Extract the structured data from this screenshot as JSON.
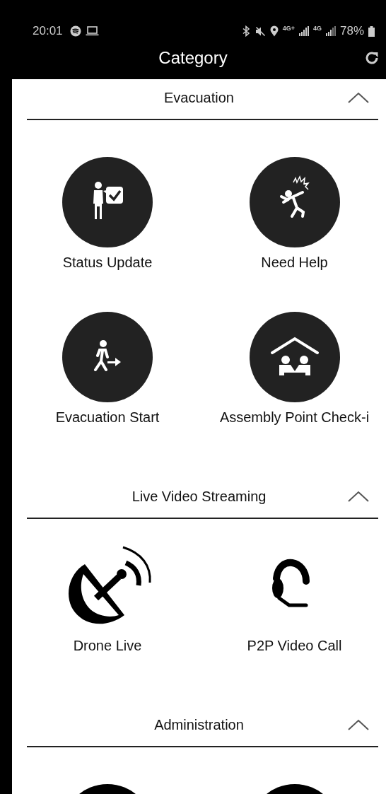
{
  "status_bar": {
    "time": "20:01",
    "network_1": "4G+",
    "network_2": "4G",
    "battery": "78%"
  },
  "header": {
    "title": "Category"
  },
  "sections": [
    {
      "title": "Evacuation",
      "expanded": true,
      "items": [
        {
          "label": "Status Update",
          "kind": "circle"
        },
        {
          "label": "Need Help",
          "kind": "circle"
        },
        {
          "label": "Evacuation Start",
          "kind": "circle"
        },
        {
          "label": "Assembly Point Check-i",
          "kind": "circle"
        }
      ]
    },
    {
      "title": "Live Video Streaming",
      "expanded": true,
      "items": [
        {
          "label": "Drone Live",
          "kind": "plain"
        },
        {
          "label": "P2P Video Call",
          "kind": "plain"
        }
      ]
    },
    {
      "title": "Administration",
      "expanded": true,
      "items": [
        {
          "kind": "solid"
        },
        {
          "kind": "solid"
        }
      ]
    }
  ]
}
